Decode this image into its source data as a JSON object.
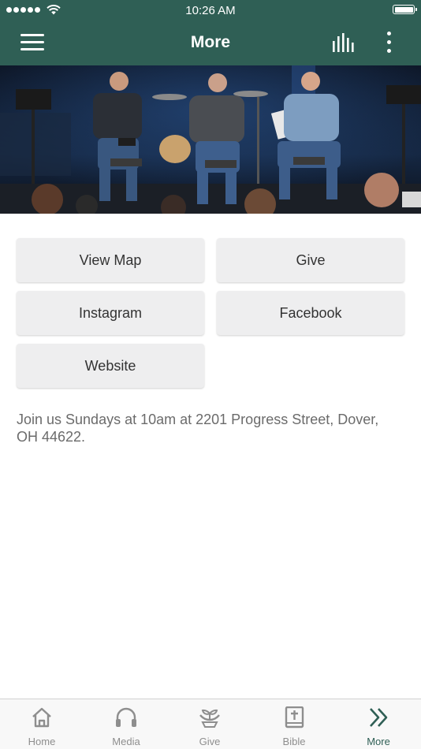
{
  "status_bar": {
    "time": "10:26 AM"
  },
  "header": {
    "title": "More",
    "menu_icon": "hamburger-menu-icon",
    "audio_icon": "audio-bars-icon",
    "more_icon": "vertical-dots-icon"
  },
  "hero": {
    "image": "three-men-seated-on-stage-photo"
  },
  "buttons": [
    {
      "label": "View Map"
    },
    {
      "label": "Give"
    },
    {
      "label": "Instagram"
    },
    {
      "label": "Facebook"
    },
    {
      "label": "Website"
    }
  ],
  "info": {
    "text": "Join us Sundays at 10am at 2201 Progress Street, Dover, OH 44622."
  },
  "tabs": [
    {
      "label": "Home",
      "icon": "home-icon"
    },
    {
      "label": "Media",
      "icon": "headphones-icon"
    },
    {
      "label": "Give",
      "icon": "give-sprout-icon"
    },
    {
      "label": "Bible",
      "icon": "bible-icon"
    },
    {
      "label": "More",
      "icon": "chevrons-right-icon",
      "active": true
    }
  ],
  "colors": {
    "brand": "#2f5f55",
    "button_bg": "#eeeeef",
    "tab_inactive": "#8e8e8e",
    "text_muted": "#6b6b6b"
  }
}
